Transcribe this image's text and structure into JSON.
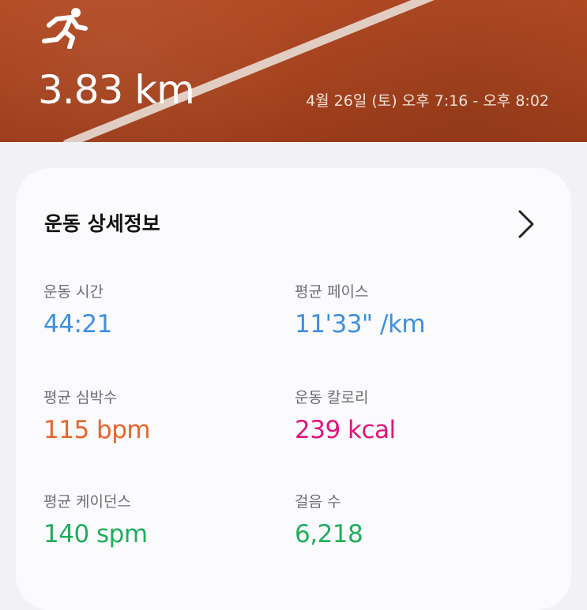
{
  "hero": {
    "icon": "running-person-icon",
    "distance": "3.83 km",
    "datetime": "4월 26일 (토) 오후 7:16 - 오후 8:02"
  },
  "details": {
    "title": "운동 상세정보",
    "chevron_icon": "chevron-right-icon",
    "stats": [
      {
        "label": "운동 시간",
        "value": "44:21",
        "color": "#3d8fe0"
      },
      {
        "label": "평균 페이스",
        "value": "11'33\" /km",
        "color": "#3d8fe0"
      },
      {
        "label": "평균 심박수",
        "value": "115 bpm",
        "color": "#e8652b"
      },
      {
        "label": "운동 칼로리",
        "value": "239 kcal",
        "color": "#e0157a"
      },
      {
        "label": "평균 케이던스",
        "value": "140 spm",
        "color": "#1fae5c"
      },
      {
        "label": "걸음 수",
        "value": "6,218",
        "color": "#1fae5c"
      }
    ]
  }
}
